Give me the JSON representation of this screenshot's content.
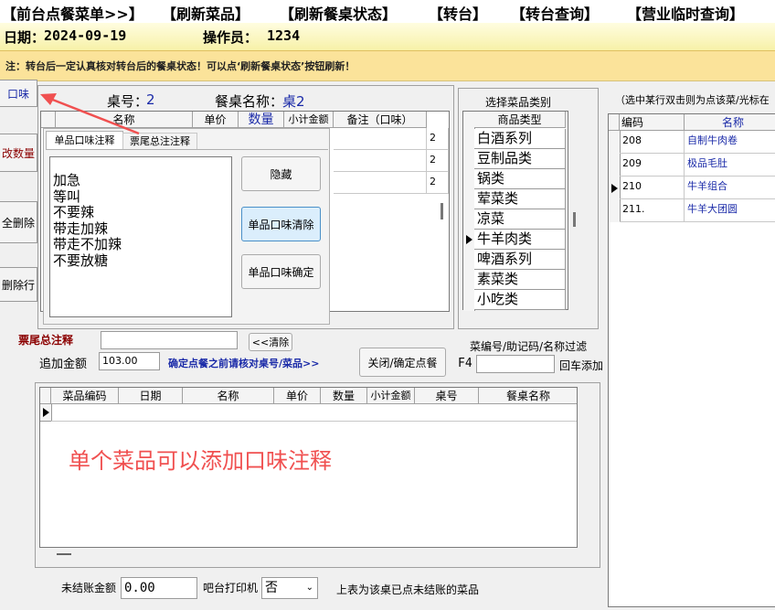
{
  "menu": [
    "【前台点餐菜单>>】",
    "【刷新菜品】",
    "【刷新餐桌状态】",
    "【转台】",
    "【转台查询】",
    "【营业临时查询】"
  ],
  "info": {
    "date_label": "日期：",
    "date": "2024-09-19",
    "operator_label": "操作员：",
    "operator": "1234"
  },
  "note": "注：转台后一定认真核对转台后的餐桌状态！可以点‘刷新餐桌状态’按钮刷新！",
  "side_buttons": [
    "口味",
    "改数量",
    "全删除",
    "删除行"
  ],
  "table_info": {
    "table_no_label": "桌号：",
    "table_no": "2",
    "table_name_label": "餐桌名称：",
    "table_name": "桌2"
  },
  "order_grid": {
    "columns": [
      "名称",
      "单价",
      "数量",
      "小计金额",
      "备注（口味）"
    ],
    "row_marks": [
      "2",
      "2",
      "2"
    ]
  },
  "taste_popup": {
    "tabs": [
      "单品口味注释",
      "票尾总注注释"
    ],
    "options": [
      "加急",
      "等叫",
      "不要辣",
      "带走加辣",
      "带走不加辣",
      "不要放糖"
    ],
    "buttons": [
      "隐藏",
      "单品口味清除",
      "单品口味确定"
    ]
  },
  "category": {
    "title": "选择菜品类别",
    "header": "商品类型",
    "items": [
      "白酒系列",
      "豆制品类",
      "锅类",
      "荤菜类",
      "凉菜",
      "牛羊肉类",
      "啤酒系列",
      "素菜类",
      "小吃类"
    ],
    "selected_index": 5
  },
  "dish_list": {
    "hint": "（选中某行双击则为点该菜/光标在",
    "columns": [
      "编码",
      "名称"
    ],
    "rows": [
      {
        "code": "208",
        "name": "自制牛肉卷"
      },
      {
        "code": "209",
        "name": "极品毛肚"
      },
      {
        "code": "210",
        "name": "牛羊组合"
      },
      {
        "code": "211.",
        "name": "牛羊大团圆"
      }
    ]
  },
  "footer_note": {
    "label": "票尾总注释",
    "clear_button": "<<清除"
  },
  "extra": {
    "label": "追加金额",
    "value": "103.00",
    "warning": "确定点餐之前请核对桌号/菜品>>",
    "confirm_button": "关闭/确定点餐"
  },
  "filter": {
    "label": "菜编号/助记码/名称过滤",
    "key": "F4",
    "enter_hint": "回车添加"
  },
  "history_grid": {
    "columns": [
      "菜品编码",
      "日期",
      "名称",
      "单价",
      "数量",
      "小计金额",
      "桌号",
      "餐桌名称"
    ]
  },
  "annotation": "单个菜品可以添加口味注释",
  "bottom": {
    "unpaid_label": "未结账金额",
    "unpaid_value": "0.00",
    "printer_label": "吧台打印机",
    "printer_value": "否",
    "desc": "上表为该桌已点未结账的菜品"
  },
  "colors": {
    "accent_blue": "#1a2aa8",
    "annotation_red": "#f05050",
    "note_bg": "#fbe39a"
  }
}
